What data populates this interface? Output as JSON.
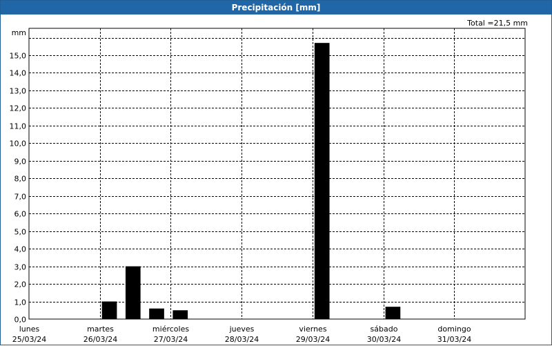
{
  "window": {
    "title": "Precipitación [mm]"
  },
  "total_label": "Total =21,5 mm",
  "colors": {
    "title_bar": "#2166a6",
    "bar": "#000000",
    "grid": "#000000"
  },
  "chart_data": {
    "type": "bar",
    "title": "Precipitación [mm]",
    "ylabel": "mm",
    "ylim": [
      0,
      16
    ],
    "yticks": [
      "0,0",
      "1,0",
      "2,0",
      "3,0",
      "4,0",
      "5,0",
      "6,0",
      "7,0",
      "8,0",
      "9,0",
      "10,0",
      "11,0",
      "12,0",
      "13,0",
      "14,0",
      "15,0"
    ],
    "x_start": "2024-03-25",
    "x_end": "2024-04-01",
    "day_labels": [
      {
        "day": "lunes",
        "date": "25/03/24"
      },
      {
        "day": "martes",
        "date": "26/03/24"
      },
      {
        "day": "miércoles",
        "date": "27/03/24"
      },
      {
        "day": "jueves",
        "date": "28/03/24"
      },
      {
        "day": "viernes",
        "date": "29/03/24"
      },
      {
        "day": "sábado",
        "date": "30/03/24"
      },
      {
        "day": "domingo",
        "date": "31/03/24"
      }
    ],
    "bars": [
      {
        "start": "2024-03-26 00:00",
        "end": "2024-03-26 06:00",
        "value": 1.0
      },
      {
        "start": "2024-03-26 08:00",
        "end": "2024-03-26 14:00",
        "value": 3.0
      },
      {
        "start": "2024-03-26 16:00",
        "end": "2024-03-26 22:00",
        "value": 0.6
      },
      {
        "start": "2024-03-27 00:00",
        "end": "2024-03-27 06:00",
        "value": 0.5
      },
      {
        "start": "2024-03-29 00:00",
        "end": "2024-03-29 06:00",
        "value": 15.7
      },
      {
        "start": "2024-03-30 00:00",
        "end": "2024-03-30 06:00",
        "value": 0.7
      }
    ],
    "grid": true,
    "legend": "none"
  }
}
